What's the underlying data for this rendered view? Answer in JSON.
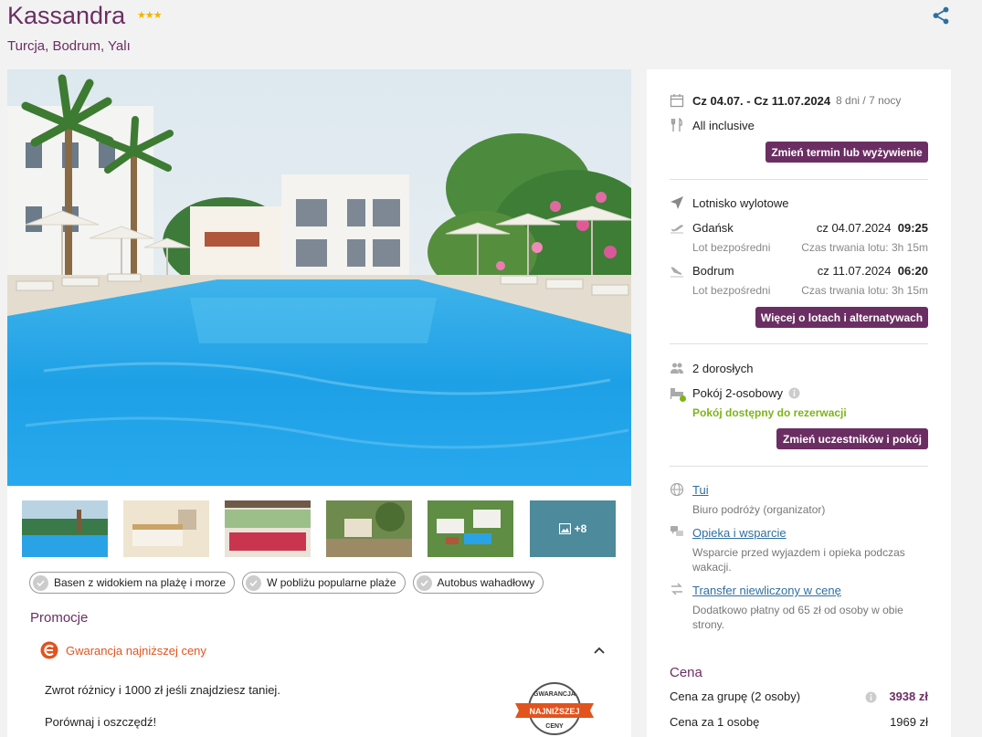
{
  "hotel": {
    "name": "Kassandra",
    "stars": "★★★",
    "location": "Turcja, Bodrum, Yalı"
  },
  "gallery": {
    "more_label": "+8"
  },
  "tags": [
    "Basen z widokiem na plażę i morze",
    "W pobliżu popularne plaże",
    "Autobus wahadłowy"
  ],
  "promo": {
    "heading": "Promocje",
    "item_label": "Gwarancja najniższej ceny",
    "text1": "Zwrot różnicy i 1000 zł jeśli znajdziesz taniej.",
    "text2": "Porównaj i oszczędź!",
    "badge_top": "GWARANCJA",
    "badge_mid": "NAJNIŻSZEJ",
    "badge_bot": "CENY"
  },
  "trip": {
    "dates": "Cz 04.07. - Cz 11.07.2024",
    "duration": "8 dni / 7 nocy",
    "board": "All inclusive",
    "change_button": "Zmień termin lub wyżywienie"
  },
  "flights": {
    "heading": "Lotnisko wylotowe",
    "outbound": {
      "city": "Gdańsk",
      "date": "cz 04.07.2024",
      "time": "09:25",
      "type": "Lot bezpośredni",
      "duration": "Czas trwania lotu: 3h 15m"
    },
    "inbound": {
      "city": "Bodrum",
      "date": "cz 11.07.2024",
      "time": "06:20",
      "type": "Lot bezpośredni",
      "duration": "Czas trwania lotu: 3h 15m"
    },
    "more_button": "Więcej o lotach i alternatywach"
  },
  "participants": {
    "adults": "2 dorosłych",
    "room": "Pokój 2-osobowy",
    "availability": "Pokój dostępny do rezerwacji",
    "change_button": "Zmień uczestników i pokój"
  },
  "services": {
    "organizer_link": "Tui",
    "organizer_desc": "Biuro podróży (organizator)",
    "support_link": "Opieka i wsparcie",
    "support_desc": "Wsparcie przed wyjazdem i opieka podczas wakacji.",
    "transfer_link": "Transfer niewliczony w cenę",
    "transfer_desc": "Dodatkowo płatny od 65 zł od osoby w obie strony."
  },
  "price": {
    "heading": "Cena",
    "group_label": "Cena za grupę (2 osoby)",
    "group_value": "3938 zł",
    "person_label": "Cena za 1 osobę",
    "person_value": "1969 zł"
  },
  "colors": {
    "brand": "#6b2e63",
    "promo": "#e2531e",
    "available": "#7cb518",
    "link": "#2f6fa0"
  }
}
